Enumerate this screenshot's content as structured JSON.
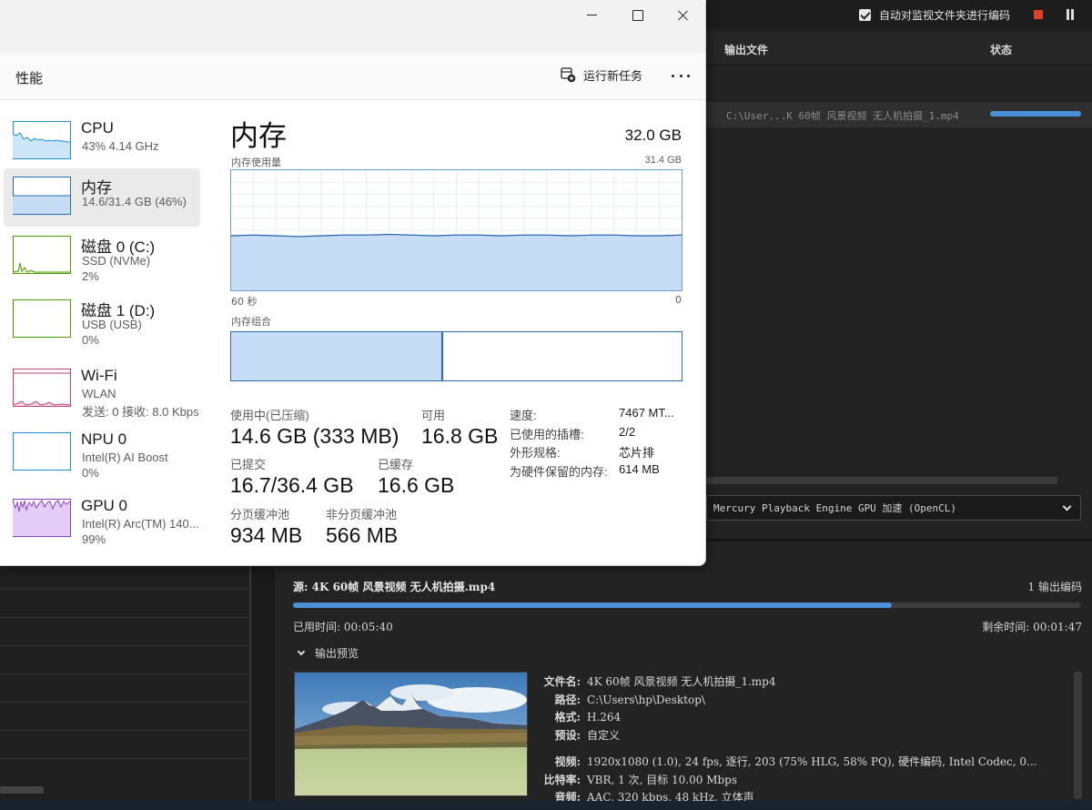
{
  "media_encoder": {
    "auto_watch_label": "自动对监视文件夹进行编码",
    "columns": {
      "output_file": "输出文件",
      "status": "状态"
    },
    "queue_row_file": "C:\\User...K 60帧 风景视频 无人机拍摄_1.mp4",
    "queue_row_progress": 1.0,
    "renderer": "Mercury Playback Engine GPU 加速 (OpenCL)",
    "encoding": {
      "source": "源: 4K 60帧 风景视频 无人机拍摄.mp4",
      "output_count": "1 输出编码",
      "progress": 0.76,
      "elapsed": "已用时间: 00:05:40",
      "remaining": "剩余时间: 00:01:47",
      "preview_label": "输出预览",
      "info": [
        {
          "k": "文件名:",
          "v": "4K 60帧 风景视频 无人机拍摄_1.mp4"
        },
        {
          "k": "路径:",
          "v": "C:\\Users\\hp\\Desktop\\"
        },
        {
          "k": "格式:",
          "v": "H.264"
        },
        {
          "k": "预设:",
          "v": "自定义"
        },
        {
          "k": "",
          "v": ""
        },
        {
          "k": "视频:",
          "v": "1920x1080 (1.0), 24 fps, 逐行, 203 (75% HLG, 58% PQ), 硬件编码, Intel Codec, 0..."
        },
        {
          "k": "比特率:",
          "v": "VBR, 1 次, 目标 10.00 Mbps"
        },
        {
          "k": "音频:",
          "v": "AAC, 320 kbps, 48 kHz, 立体声"
        }
      ]
    }
  },
  "task_manager": {
    "page_title": "性能",
    "run_new_task": "运行新任务",
    "sidebar": [
      {
        "name": "CPU",
        "sub1": "43% 4.14 GHz",
        "sub2": "",
        "kind": "cpu",
        "color": "#1f8fd1"
      },
      {
        "name": "内存",
        "sub1": "14.6/31.4 GB (46%)",
        "sub2": "",
        "kind": "mem",
        "color": "#2d6bb3"
      },
      {
        "name": "磁盘 0 (C:)",
        "sub1": "SSD (NVMe)",
        "sub2": "2%",
        "kind": "disk",
        "color": "#4e9a06"
      },
      {
        "name": "磁盘 1 (D:)",
        "sub1": "USB (USB)",
        "sub2": "0%",
        "kind": "disk1",
        "color": "#4e9a06"
      },
      {
        "name": "Wi-Fi",
        "sub1": "WLAN",
        "sub2": "发送: 0 接收: 8.0 Kbps",
        "kind": "wifi",
        "color": "#c2417a"
      },
      {
        "name": "NPU 0",
        "sub1": "Intel(R) AI Boost",
        "sub2": "0%",
        "kind": "npu",
        "color": "#1f8fd1"
      },
      {
        "name": "GPU 0",
        "sub1": "Intel(R) Arc(TM) 140...",
        "sub2": "99%",
        "kind": "gpu",
        "color": "#8a3fc7"
      }
    ],
    "memory": {
      "title": "内存",
      "total": "32.0 GB",
      "usage_label": "内存使用量",
      "usage_max": "31.4 GB",
      "usage_fraction": 0.46,
      "x_left": "60 秒",
      "x_right": "0",
      "composition_label": "内存组合",
      "composition_in_use_fraction": 0.47,
      "stats": {
        "in_use_label": "使用中(已压缩)",
        "in_use": "14.6 GB (333 MB)",
        "available_label": "可用",
        "available": "16.8 GB",
        "committed_label": "已提交",
        "committed": "16.7/36.4 GB",
        "cached_label": "已缓存",
        "cached": "16.6 GB",
        "paged_label": "分页缓冲池",
        "paged": "934 MB",
        "nonpaged_label": "非分页缓冲池",
        "nonpaged": "566 MB"
      },
      "specs": [
        {
          "k": "速度:",
          "v": "7467 MT..."
        },
        {
          "k": "已使用的插槽:",
          "v": "2/2"
        },
        {
          "k": "外形规格:",
          "v": "芯片排"
        },
        {
          "k": "为硬件保留的内存:",
          "v": "614 MB"
        }
      ]
    }
  }
}
